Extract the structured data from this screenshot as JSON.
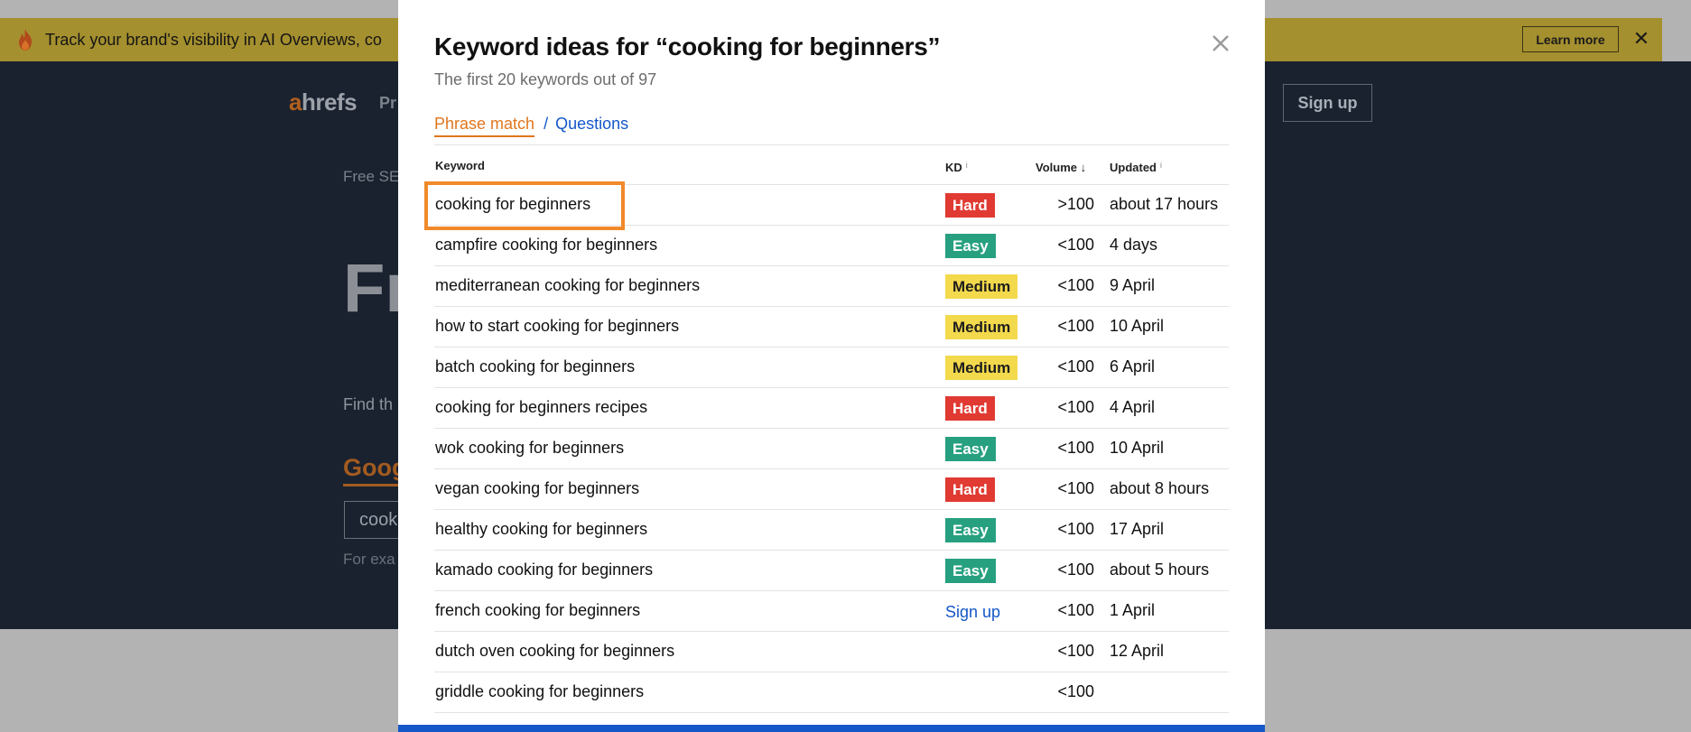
{
  "banner": {
    "text": "Track your brand's visibility in AI Overviews, co",
    "learn_more": "Learn more",
    "close": "✕"
  },
  "background": {
    "logo_a": "a",
    "logo_rest": "hrefs",
    "nav_stub": "Pr",
    "signup": "Sign up",
    "breadcrumb": "Free SE",
    "hero": "Fr",
    "find": "Find th",
    "google_tab": "Goog",
    "search_value": "cook",
    "example": "For exa"
  },
  "modal": {
    "title": "Keyword ideas for “cooking for beginners”",
    "subtitle": "The first 20 keywords out of 97",
    "tabs": {
      "phrase": "Phrase match",
      "separator": "/",
      "questions": "Questions"
    },
    "columns": {
      "keyword": "Keyword",
      "kd": "KD",
      "volume": "Volume",
      "volume_arrow": "↓",
      "updated": "Updated",
      "info": "i"
    },
    "rows": [
      {
        "keyword": "cooking for beginners",
        "kd": "Hard",
        "kd_level": "hard",
        "volume": ">100",
        "updated": "about 17 hours"
      },
      {
        "keyword": "campfire cooking for beginners",
        "kd": "Easy",
        "kd_level": "easy",
        "volume": "<100",
        "updated": "4 days"
      },
      {
        "keyword": "mediterranean cooking for beginners",
        "kd": "Medium",
        "kd_level": "medium",
        "volume": "<100",
        "updated": "9 April"
      },
      {
        "keyword": "how to start cooking for beginners",
        "kd": "Medium",
        "kd_level": "medium",
        "volume": "<100",
        "updated": "10 April"
      },
      {
        "keyword": "batch cooking for beginners",
        "kd": "Medium",
        "kd_level": "medium",
        "volume": "<100",
        "updated": "6 April"
      },
      {
        "keyword": "cooking for beginners recipes",
        "kd": "Hard",
        "kd_level": "hard",
        "volume": "<100",
        "updated": "4 April"
      },
      {
        "keyword": "wok cooking for beginners",
        "kd": "Easy",
        "kd_level": "easy",
        "volume": "<100",
        "updated": "10 April"
      },
      {
        "keyword": "vegan cooking for beginners",
        "kd": "Hard",
        "kd_level": "hard",
        "volume": "<100",
        "updated": "about 8 hours"
      },
      {
        "keyword": "healthy cooking for beginners",
        "kd": "Easy",
        "kd_level": "easy",
        "volume": "<100",
        "updated": "17 April"
      },
      {
        "keyword": "kamado cooking for beginners",
        "kd": "Easy",
        "kd_level": "easy",
        "volume": "<100",
        "updated": "about 5 hours"
      },
      {
        "keyword": "french cooking for beginners",
        "kd": "Sign up",
        "kd_level": "link",
        "volume": "<100",
        "updated": "1 April"
      },
      {
        "keyword": "dutch oven cooking for beginners",
        "kd": "",
        "kd_level": "none",
        "volume": "<100",
        "updated": "12 April"
      },
      {
        "keyword": "griddle cooking for beginners",
        "kd": "",
        "kd_level": "none",
        "volume": "<100",
        "updated": ""
      }
    ]
  },
  "colors": {
    "hard": "#e03a32",
    "easy": "#27a080",
    "medium": "#f3d94c",
    "accent_orange": "#e0761e",
    "link_blue": "#1457c8"
  }
}
